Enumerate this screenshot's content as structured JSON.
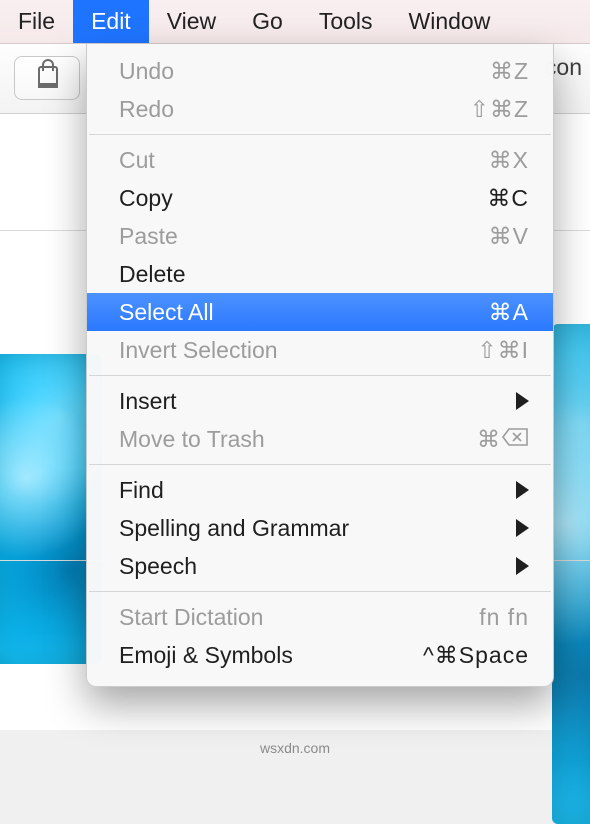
{
  "menubar": {
    "items": [
      {
        "label": "File"
      },
      {
        "label": "Edit"
      },
      {
        "label": "View"
      },
      {
        "label": "Go"
      },
      {
        "label": "Tools"
      },
      {
        "label": "Window"
      }
    ],
    "active_index": 1
  },
  "backdrop": {
    "toolbar_partial_text": "con",
    "watermark": "wsxdn.com"
  },
  "dropdown": {
    "groups": [
      [
        {
          "id": "undo",
          "label": "Undo",
          "shortcut": "⌘Z",
          "enabled": false
        },
        {
          "id": "redo",
          "label": "Redo",
          "shortcut": "⇧⌘Z",
          "enabled": false
        }
      ],
      [
        {
          "id": "cut",
          "label": "Cut",
          "shortcut": "⌘X",
          "enabled": false
        },
        {
          "id": "copy",
          "label": "Copy",
          "shortcut": "⌘C",
          "enabled": true
        },
        {
          "id": "paste",
          "label": "Paste",
          "shortcut": "⌘V",
          "enabled": false
        },
        {
          "id": "delete",
          "label": "Delete",
          "shortcut": "",
          "enabled": true
        },
        {
          "id": "select-all",
          "label": "Select All",
          "shortcut": "⌘A",
          "enabled": true,
          "highlight": true
        },
        {
          "id": "invert-selection",
          "label": "Invert Selection",
          "shortcut": "⇧⌘I",
          "enabled": false
        }
      ],
      [
        {
          "id": "insert",
          "label": "Insert",
          "submenu": true,
          "enabled": true
        },
        {
          "id": "move-to-trash",
          "label": "Move to Trash",
          "shortcut": "⌘⌫",
          "enabled": false,
          "del_icon": true
        }
      ],
      [
        {
          "id": "find",
          "label": "Find",
          "submenu": true,
          "enabled": true
        },
        {
          "id": "spelling-grammar",
          "label": "Spelling and Grammar",
          "submenu": true,
          "enabled": true
        },
        {
          "id": "speech",
          "label": "Speech",
          "submenu": true,
          "enabled": true
        }
      ],
      [
        {
          "id": "start-dictation",
          "label": "Start Dictation",
          "shortcut": "fn fn",
          "enabled": false
        },
        {
          "id": "emoji-symbols",
          "label": "Emoji & Symbols",
          "shortcut": "^⌘Space",
          "enabled": true
        }
      ]
    ]
  }
}
